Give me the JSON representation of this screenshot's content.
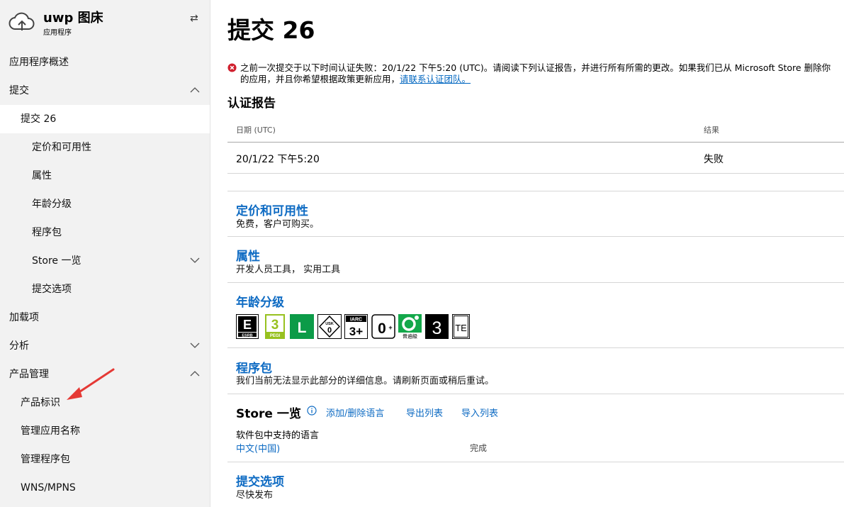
{
  "sidebar": {
    "app_name": "uwp 图床",
    "app_subtitle": "应用程序",
    "collapse_glyph": "⇄",
    "items": [
      {
        "label": "应用程序概述"
      },
      {
        "label": "提交"
      },
      {
        "label": "提交 26"
      },
      {
        "label": "定价和可用性"
      },
      {
        "label": "属性"
      },
      {
        "label": "年龄分级"
      },
      {
        "label": "程序包"
      },
      {
        "label": "Store 一览"
      },
      {
        "label": "提交选项"
      },
      {
        "label": "加载项"
      },
      {
        "label": "分析"
      },
      {
        "label": "产品管理"
      },
      {
        "label": "产品标识"
      },
      {
        "label": "管理应用名称"
      },
      {
        "label": "管理程序包"
      },
      {
        "label": "WNS/MPNS"
      }
    ]
  },
  "main": {
    "title": "提交 26",
    "error": {
      "text": "之前一次提交于以下时间认证失败：20/1/22 下午5:20 (UTC)。请阅读下列认证报告，并进行所有所需的更改。如果我们已从 Microsoft Store 删除你的应用，并且你希望根据政策更新应用，",
      "link": "请联系认证团队。"
    },
    "report": {
      "title": "认证报告",
      "columns": [
        "日期 (UTC)",
        "结果"
      ],
      "rows": [
        {
          "date": "20/1/22 下午5:20",
          "result": "失败"
        }
      ]
    },
    "pricing": {
      "title": "定价和可用性",
      "subtitle": "免费，客户可购买。"
    },
    "properties": {
      "title": "属性",
      "subtitle": "开发人员工具， 实用工具"
    },
    "age_rating": {
      "title": "年龄分级",
      "badges": [
        "ESRB E",
        "PEGI 3",
        "ClassInd L",
        "USK 0",
        "IARC 3+",
        "0+",
        "普遍級",
        "3",
        "TE"
      ]
    },
    "packages": {
      "title": "程序包",
      "subtitle": "我们当前无法显示此部分的详细信息。请刷新页面或稍后重试。"
    },
    "store": {
      "title": "Store 一览",
      "actions": [
        "添加/删除语言",
        "导出列表",
        "导入列表"
      ],
      "languages_label": "软件包中支持的语言",
      "language": "中文(中国)",
      "language_status": "完成"
    },
    "submission_options": {
      "title": "提交选项",
      "subtitle": "尽快发布"
    }
  },
  "colors": {
    "link": "#0e6bc3",
    "error": "#d0202e",
    "sidebar_bg": "#f2f2f2",
    "annotation_arrow": "#e53935"
  }
}
